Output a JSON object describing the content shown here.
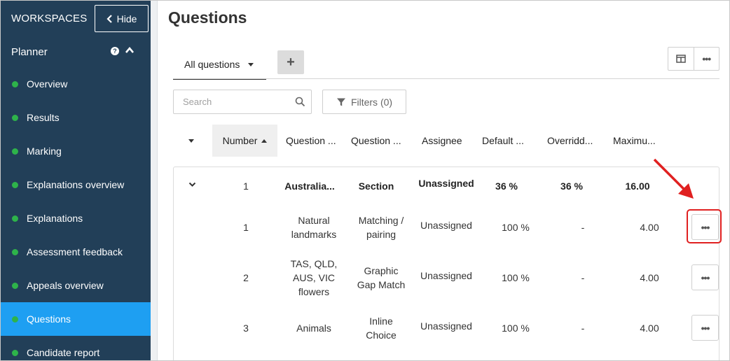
{
  "sidebar": {
    "workspaces_label": "WORKSPACES",
    "hide_label": "Hide",
    "planner_label": "Planner",
    "help_glyph": "?",
    "items": [
      {
        "label": "Overview",
        "active": false
      },
      {
        "label": "Results",
        "active": false
      },
      {
        "label": "Marking",
        "active": false
      },
      {
        "label": "Explanations overview",
        "active": false
      },
      {
        "label": "Explanations",
        "active": false
      },
      {
        "label": "Assessment feedback",
        "active": false
      },
      {
        "label": "Appeals overview",
        "active": false
      },
      {
        "label": "Questions",
        "active": true
      },
      {
        "label": "Candidate report",
        "active": false
      }
    ],
    "dot_color": "#2eb34a",
    "active_color": "#1e9ff2",
    "bg_color": "#223f58"
  },
  "main": {
    "title": "Questions",
    "tab_label": "All questions",
    "add_tab_glyph": "+",
    "search_placeholder": "Search",
    "filters_label": "Filters (0)",
    "more_glyph": "•••"
  },
  "table": {
    "headers": {
      "number": "Number",
      "question_title": "Question ...",
      "question_type": "Question ...",
      "assignee": "Assignee",
      "default": "Default ...",
      "overridden": "Overridd...",
      "maximum": "Maximu..."
    },
    "group": {
      "number": "1",
      "title": "Australia...",
      "type": "Section",
      "assignee": "Unassigned",
      "default": "36 %",
      "overridden": "36 %",
      "maximum": "16.00"
    },
    "rows": [
      {
        "number": "1",
        "title_lines": [
          "Natural",
          "landmarks"
        ],
        "type_lines": [
          "Matching /",
          "pairing"
        ],
        "assignee": "Unassigned",
        "default": "100 %",
        "overridden": "-",
        "maximum": "4.00"
      },
      {
        "number": "2",
        "title_lines": [
          "TAS, QLD,",
          "AUS, VIC",
          "flowers"
        ],
        "type_lines": [
          "Graphic",
          "Gap Match"
        ],
        "assignee": "Unassigned",
        "default": "100 %",
        "overridden": "-",
        "maximum": "4.00"
      },
      {
        "number": "3",
        "title_lines": [
          "Animals"
        ],
        "type_lines": [
          "Inline",
          "Choice"
        ],
        "assignee": "Unassigned",
        "default": "100 %",
        "overridden": "-",
        "maximum": "4.00"
      }
    ]
  },
  "annotation": {
    "color": "#e02020"
  }
}
